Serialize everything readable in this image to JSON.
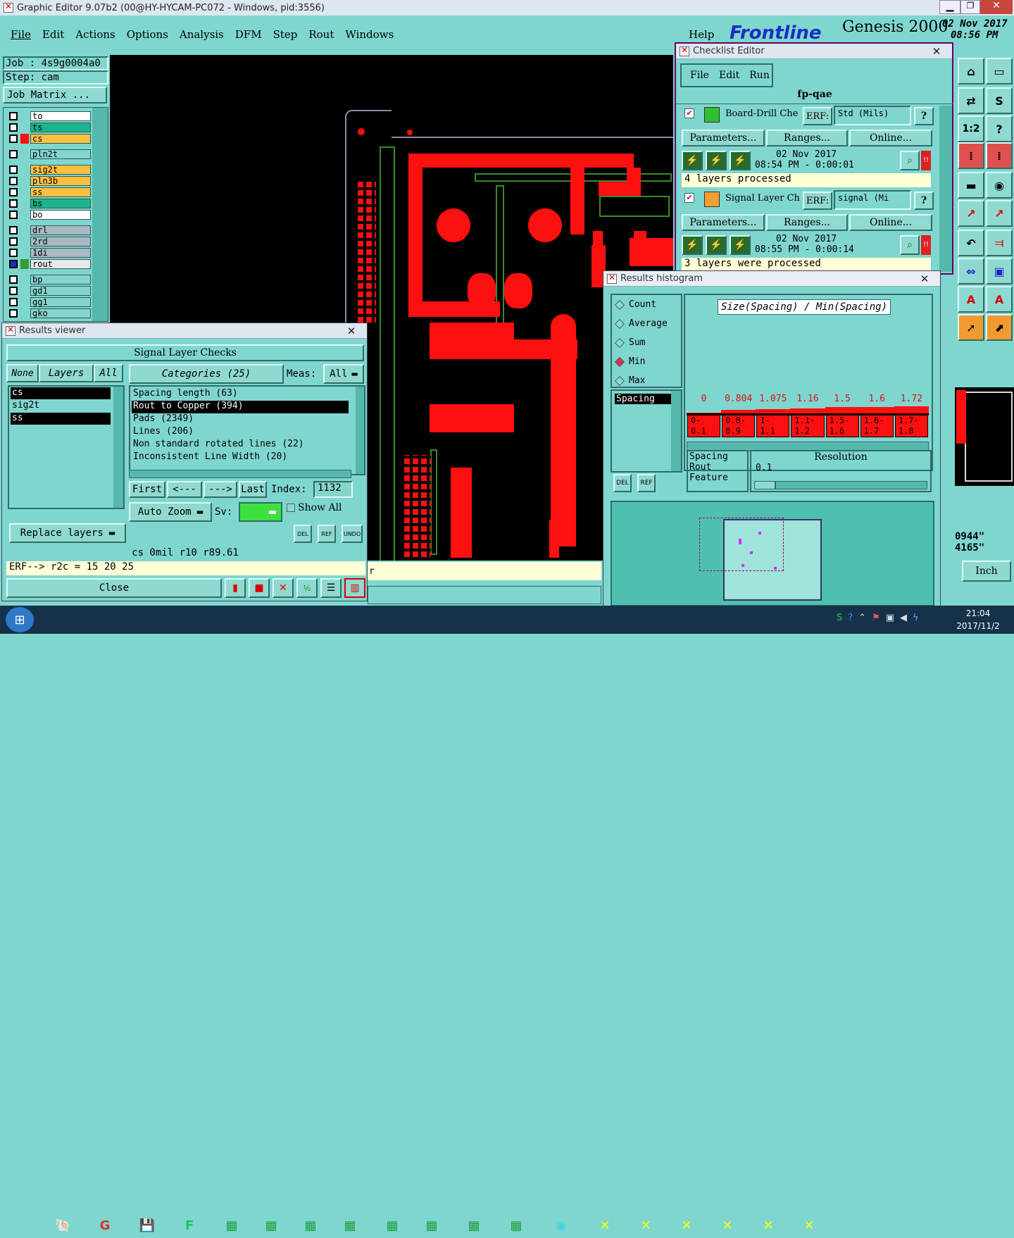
{
  "app": {
    "window_title": "Graphic Editor 9.07b2 (00@HY-HYCAM-PC072 - Windows, pid:3556)",
    "menu": [
      "File",
      "Edit",
      "Actions",
      "Options",
      "Analysis",
      "DFM",
      "Step",
      "Rout",
      "Windows"
    ],
    "help": "Help",
    "brand": "Frontline",
    "product": "Genesis 2000",
    "date": "02 Nov 2017",
    "time": "08:56 PM"
  },
  "job": {
    "job_label": "Job : 4s9g0004a0",
    "step_label": "Step: cam",
    "matrix_button": "Job Matrix ..."
  },
  "layers": [
    {
      "name": "to",
      "color": "#ffffff"
    },
    {
      "name": "ts",
      "color": "#1cb48c"
    },
    {
      "name": "cs",
      "color": "#ffc040"
    },
    {
      "name": "pln2t",
      "color": "#86d5cd"
    },
    {
      "name": "sig2t",
      "color": "#ffc040"
    },
    {
      "name": "pln3b",
      "color": "#ffc040"
    },
    {
      "name": "ss",
      "color": "#ffc040"
    },
    {
      "name": "bs",
      "color": "#1cb48c"
    },
    {
      "name": "bo",
      "color": "#ffffff"
    },
    {
      "name": "drl",
      "color": "#aab8c4"
    },
    {
      "name": "2rd",
      "color": "#aab8c4"
    },
    {
      "name": "1di",
      "color": "#aab8c4"
    },
    {
      "name": "rout",
      "color": "#e8e8e8"
    },
    {
      "name": "bp",
      "color": "#86d5cd"
    },
    {
      "name": "gd1",
      "color": "#86d5cd"
    },
    {
      "name": "gg1",
      "color": "#86d5cd"
    },
    {
      "name": "gko",
      "color": "#86d5cd"
    }
  ],
  "results_viewer": {
    "title": "Results viewer",
    "header": "Signal Layer Checks",
    "none": "None",
    "layers_btn": "Layers",
    "all": "All",
    "categories": "Categories (25)",
    "meas_label": "Meas:",
    "meas_value": "All",
    "layer_list": [
      "cs",
      "sig2t",
      "ss"
    ],
    "category_list": [
      "Spacing length (63)",
      "Rout to Copper (394)",
      "Pads (2349)",
      "Lines (206)",
      "Non standard rotated lines (22)",
      "Inconsistent Line Width (20)"
    ],
    "first": "First",
    "prev": "<---",
    "next": "--->",
    "last": "Last",
    "index_label": "Index:",
    "index_value": "1132",
    "auto_zoom": "Auto Zoom",
    "sv_label": "Sv:",
    "show_all": "Show All",
    "replace_layers": "Replace layers",
    "del": "DEL",
    "ref": "REF",
    "undo": "UNDO",
    "status": "cs 0mil  r10  r89.61",
    "erf_line": "ERF--> r2c = 15 20 25",
    "close": "Close"
  },
  "checklist_editor": {
    "title": "Checklist Editor",
    "menu": [
      "File",
      "Edit",
      "Run"
    ],
    "name": "fp-qae",
    "checks": [
      {
        "name": "Board-Drill Che",
        "erf_label": "ERF:",
        "erf_value": "Std (Mils)",
        "parameters": "Parameters...",
        "ranges": "Ranges...",
        "online": "Online...",
        "date": "02 Nov 2017",
        "time": "08:54 PM - 0:00:01",
        "status": "4 layers processed"
      },
      {
        "name": "Signal Layer Ch",
        "erf_label": "ERF:",
        "erf_value": "signal (Mi",
        "parameters": "Parameters...",
        "ranges": "Ranges...",
        "online": "Online...",
        "date": "02 Nov 2017",
        "time": "08:55 PM - 0:00:14",
        "status": "3 layers were processed"
      }
    ]
  },
  "histogram": {
    "title": "Results histogram",
    "modes": [
      "Count",
      "Average",
      "Sum",
      "Min",
      "Max"
    ],
    "selected_mode": "Min",
    "chart_title": "Size(Spacing) / Min(Spacing)",
    "values": [
      "0",
      "0.804",
      "1.075",
      "1.16",
      "1.5",
      "1.6",
      "1.72"
    ],
    "bins": [
      "0-\n0.1",
      "0.8-\n0.9",
      "1-\n1.1",
      "1.1-\n1.2",
      "1.5-\n1.6",
      "1.6-\n1.7",
      "1.7-\n1.8"
    ],
    "left_list": [
      "Spacing"
    ],
    "sort_list": [
      "Spacing",
      "Rout",
      "Feature"
    ],
    "resolution_label": "Resolution",
    "resolution_value": "0.1",
    "del": "DEL",
    "ref": "REF"
  },
  "right_panel": {
    "coord1": "0944\"",
    "coord2": "4165\"",
    "units": "Inch"
  },
  "taskbar": {
    "clock_time": "21:04",
    "clock_date": "2017/11/2"
  },
  "strip_char": "r"
}
